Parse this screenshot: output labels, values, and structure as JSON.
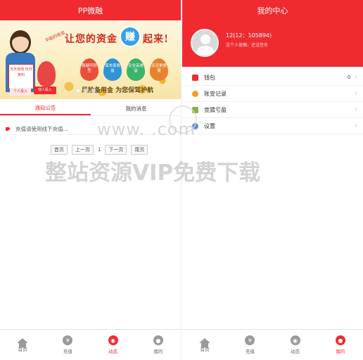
{
  "left": {
    "title": "PP微融",
    "banner": {
      "slogan": "让您的资金",
      "earn": "赚",
      "slogan_end": "起来!",
      "tag": "平稳的收益",
      "drops": [
        "稳健风险型",
        "保本保收益",
        "安全高收益",
        "灵活更便捷"
      ],
      "footer": "风险备用金   为您保驾护航",
      "board": "天天有收 日日复利",
      "person_btn": "个人投入",
      "mascot_btn": "他人投入"
    },
    "tabs": [
      "通知公告",
      "我的消息"
    ],
    "notice": "充值请使用线下充值...",
    "pager": {
      "first": "首页",
      "prev": "上一页",
      "current": "1",
      "next": "下一页",
      "last": "尾页"
    },
    "tabbar": [
      "首页",
      "充值",
      "动态",
      "我的"
    ]
  },
  "right": {
    "title": "我的中心",
    "user": {
      "name": "12(12：105894)",
      "sub": "这个人很懒，还没签名"
    },
    "menu": [
      {
        "label": "钱包",
        "value": "0",
        "color": "#ef2b30"
      },
      {
        "label": "账变记录",
        "value": "",
        "color": "#f0a020"
      },
      {
        "label": "竞猜亏盈",
        "value": "",
        "color": "#8bb040"
      },
      {
        "label": "设置",
        "value": "",
        "color": "#5b8fd6"
      }
    ],
    "tabbar": [
      "首页",
      "充值",
      "动态",
      "我的"
    ]
  },
  "watermark": {
    "line1": "www.          .com",
    "line2": "整站资源VIP免费下载"
  },
  "colors": {
    "accent": "#ef2b30"
  },
  "icons": {
    "tabbar": [
      "home-icon",
      "yen-icon",
      "dynamic-icon",
      "user-icon"
    ]
  }
}
